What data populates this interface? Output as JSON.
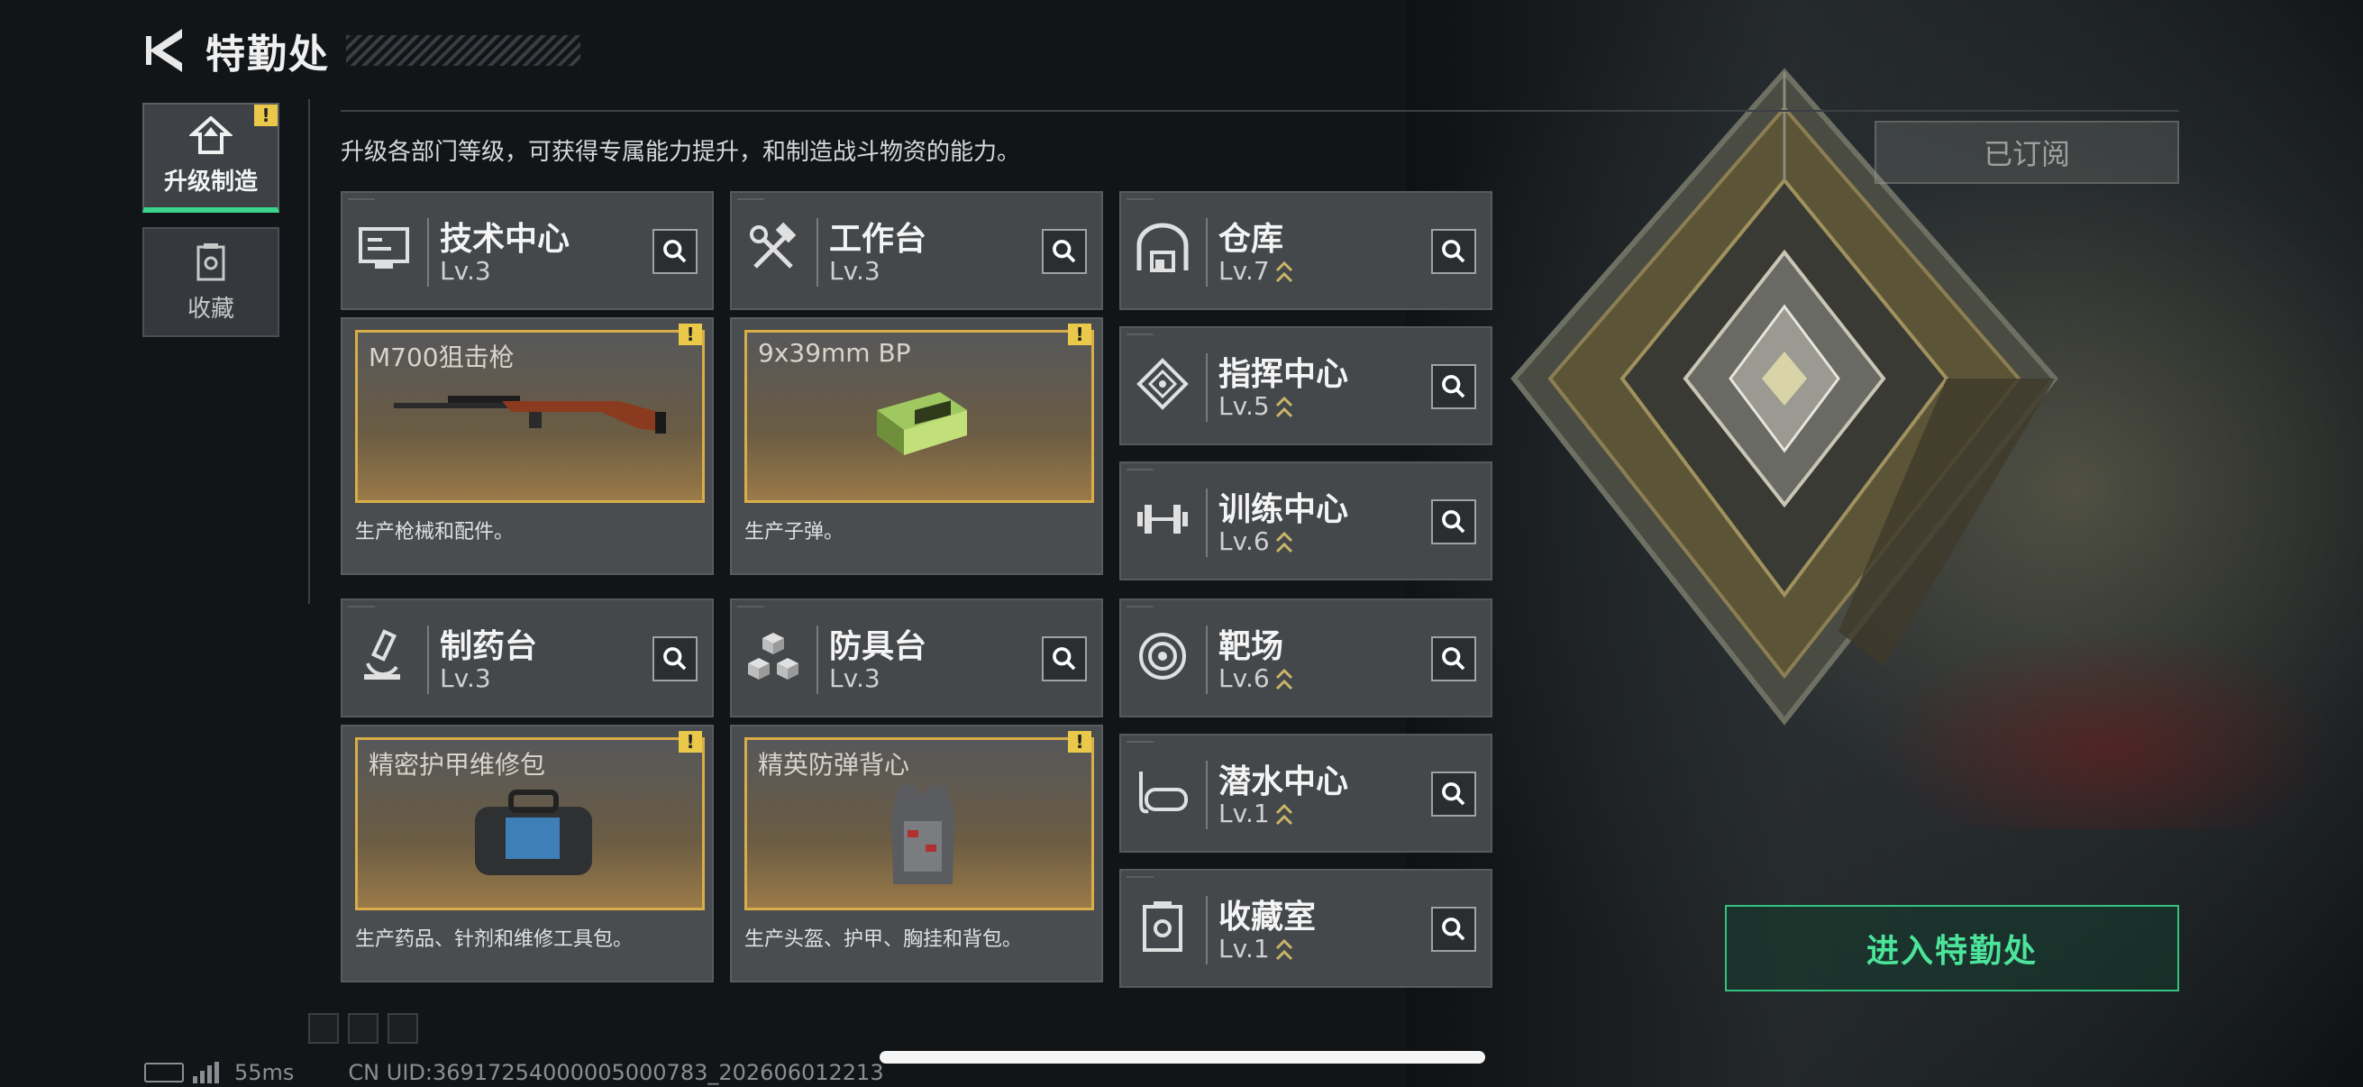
{
  "header": {
    "title": "特勤处"
  },
  "sidebar": {
    "tabs": [
      {
        "label": "升级制造",
        "active": true,
        "warning": "!"
      },
      {
        "label": "收藏",
        "active": false
      }
    ]
  },
  "description": "升级各部门等级，可获得专属能力提升，和制造战斗物资的能力。",
  "subscribe_label": "已订阅",
  "departments": [
    {
      "name": "技术中心",
      "level": "Lv.3",
      "icon": "monitor-icon"
    },
    {
      "name": "工作台",
      "level": "Lv.3",
      "icon": "tools-icon"
    },
    {
      "name": "仓库",
      "level": "Lv.7",
      "icon": "warehouse-icon",
      "upgradable": true
    },
    {
      "name": "指挥中心",
      "level": "Lv.5",
      "icon": "command-icon",
      "upgradable": true
    },
    {
      "name": "训练中心",
      "level": "Lv.6",
      "icon": "dumbbell-icon",
      "upgradable": true
    },
    {
      "name": "制药台",
      "level": "Lv.3",
      "icon": "microscope-icon"
    },
    {
      "name": "防具台",
      "level": "Lv.3",
      "icon": "cubes-icon"
    },
    {
      "name": "靶场",
      "level": "Lv.6",
      "icon": "target-icon",
      "upgradable": true
    },
    {
      "name": "潜水中心",
      "level": "Lv.1",
      "icon": "goggles-icon",
      "upgradable": true
    },
    {
      "name": "收藏室",
      "level": "Lv.1",
      "icon": "collection-icon",
      "upgradable": true
    }
  ],
  "productions": [
    {
      "item": "M700狙击枪",
      "desc": "生产枪械和配件。",
      "warning": "!"
    },
    {
      "item": "9x39mm BP",
      "desc": "生产子弹。",
      "warning": "!"
    },
    {
      "item": "精密护甲维修包",
      "desc": "生产药品、针剂和维修工具包。",
      "warning": "!"
    },
    {
      "item": "精英防弹背心",
      "desc": "生产头盔、护甲、胸挂和背包。",
      "warning": "!"
    }
  ],
  "enter_button": "进入特勤处",
  "footer": {
    "ping": "55ms",
    "uid": "CN UID:36917254000005000783_202606012213"
  },
  "colors": {
    "accent": "#3ad48b",
    "warning": "#e9c84a",
    "item_border": "#d9ad47"
  }
}
